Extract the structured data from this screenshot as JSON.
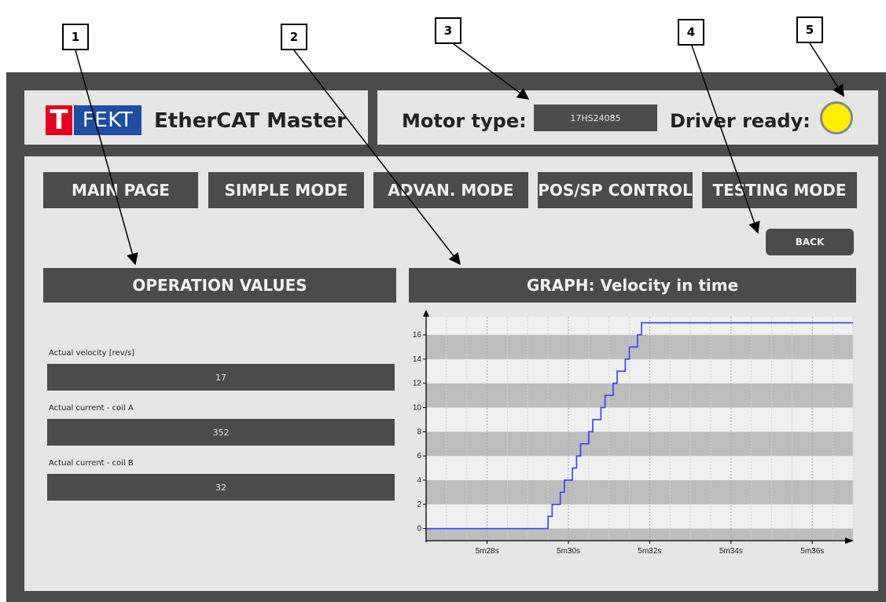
{
  "callouts": [
    "1",
    "2",
    "3",
    "4",
    "5"
  ],
  "header": {
    "logo_t": "T",
    "logo_fekt": "FEKT",
    "title": "EtherCAT Master",
    "motor_label": "Motor type:",
    "motor_value": "17HS24085",
    "driver_label": "Driver ready:",
    "driver_ready": true,
    "led_color": "#ffee00"
  },
  "nav": [
    {
      "label": "MAIN PAGE"
    },
    {
      "label": "SIMPLE MODE"
    },
    {
      "label": "ADVAN. MODE"
    },
    {
      "label": "POS/SP CONTROL"
    },
    {
      "label": "TESTING MODE"
    }
  ],
  "back_label": "BACK",
  "operation": {
    "header": "OPERATION VALUES",
    "items": [
      {
        "label": "Actual velocity [rev/s]",
        "value": "17"
      },
      {
        "label": "Actual current - coil A",
        "value": "352"
      },
      {
        "label": "Actual current - coil B",
        "value": "32"
      }
    ]
  },
  "graph_header": "GRAPH: Velocity in time",
  "colors": {
    "frame": "#4b4b4b",
    "panel": "#e6e6e6",
    "series": "#3a3aff",
    "band": "#bdbdbd"
  },
  "chart_data": {
    "type": "line",
    "title": "",
    "xlabel": "",
    "ylabel": "",
    "x_unit_seconds": true,
    "xlim": [
      326.5,
      337.0
    ],
    "ylim": [
      -1,
      17.5
    ],
    "yticks": [
      0,
      2,
      4,
      6,
      8,
      10,
      12,
      14,
      16
    ],
    "xticks": [
      {
        "t": 328,
        "label": "5m28s"
      },
      {
        "t": 330,
        "label": "5m30s"
      },
      {
        "t": 332,
        "label": "5m32s"
      },
      {
        "t": 334,
        "label": "5m34s"
      },
      {
        "t": 336,
        "label": "5m36s"
      }
    ],
    "grid": true,
    "bands": [
      [
        -1,
        0
      ],
      [
        2,
        4
      ],
      [
        6,
        8
      ],
      [
        10,
        12
      ],
      [
        14,
        16
      ]
    ],
    "series": [
      {
        "step": true,
        "x": [
          326.5,
          329.4,
          329.5,
          329.6,
          329.7,
          329.8,
          329.9,
          330.0,
          330.1,
          330.2,
          330.3,
          330.4,
          330.5,
          330.6,
          330.7,
          330.8,
          330.9,
          331.0,
          331.1,
          331.2,
          331.3,
          331.4,
          331.5,
          331.6,
          331.7,
          331.8,
          337.0
        ],
        "y": [
          0,
          0,
          1,
          2,
          2,
          3,
          4,
          4,
          5,
          6,
          7,
          7,
          8,
          9,
          9,
          10,
          11,
          11,
          12,
          13,
          13,
          14,
          15,
          15,
          16,
          17,
          17
        ]
      }
    ]
  }
}
